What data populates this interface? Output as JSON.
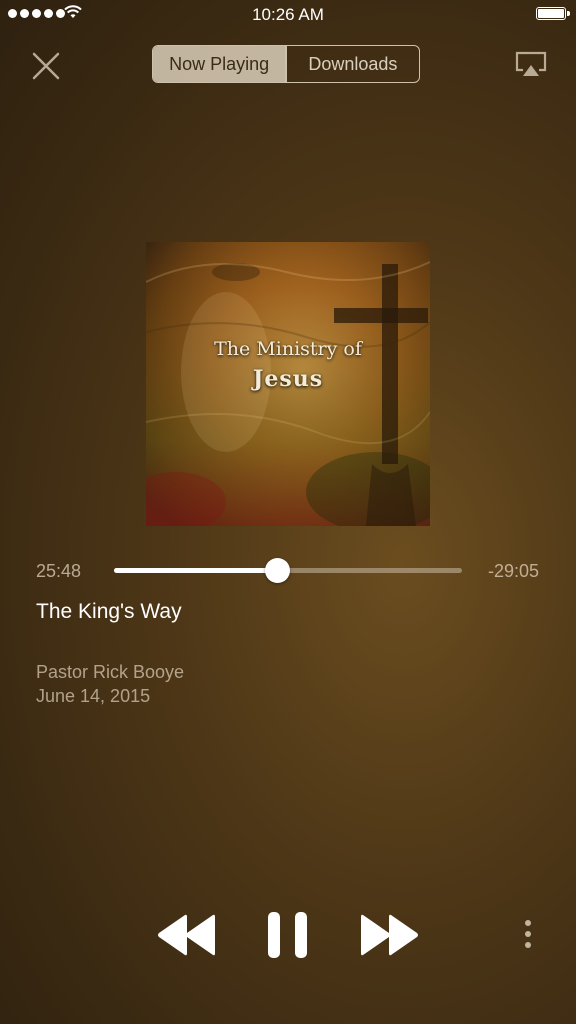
{
  "status_bar": {
    "time": "10:26 AM",
    "signal_icon": "signal-dots-icon",
    "wifi_icon": "wifi-icon",
    "battery_icon": "battery-icon"
  },
  "nav": {
    "close_icon": "close-icon",
    "segments": [
      {
        "label": "Now Playing",
        "active": true
      },
      {
        "label": "Downloads",
        "active": false
      }
    ],
    "airplay_icon": "airplay-icon"
  },
  "artwork": {
    "line1": "The Ministry of",
    "line2": "Jesus"
  },
  "progress": {
    "elapsed": "25:48",
    "remaining": "-29:05",
    "fraction": 0.47
  },
  "track": {
    "title": "The King's Way",
    "artist": "Pastor Rick Booye",
    "date": "June 14, 2015"
  },
  "controls": {
    "rewind_icon": "rewind-icon",
    "pause_icon": "pause-icon",
    "forward_icon": "fast-forward-icon",
    "more_icon": "more-vertical-icon"
  },
  "colors": {
    "background": "#4e3717",
    "segment_active": "#e1d4c0",
    "track_fill": "#ffffff"
  }
}
